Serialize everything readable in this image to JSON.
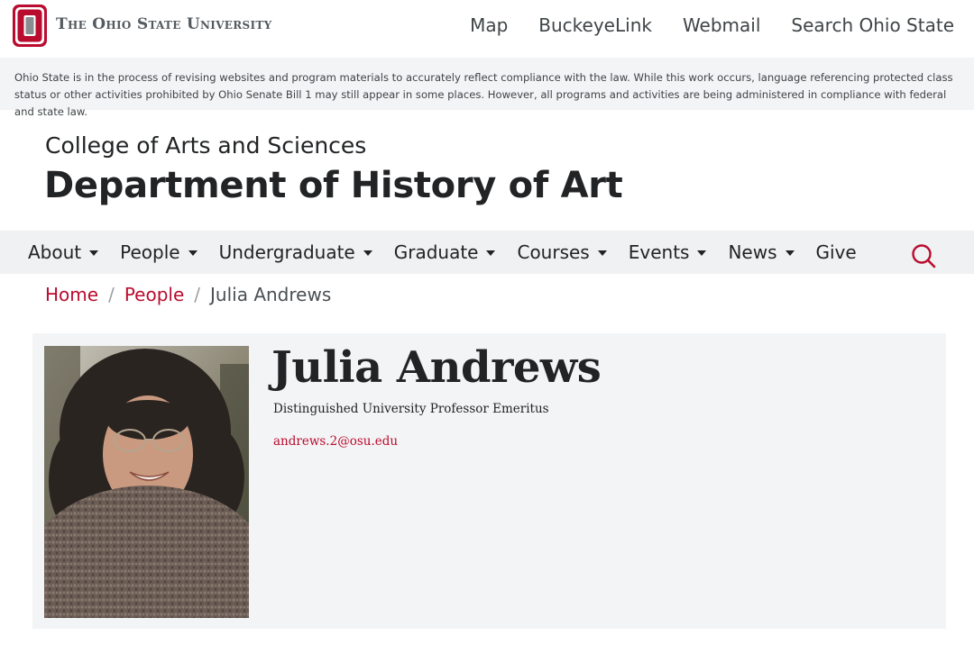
{
  "university": {
    "wordmark": "The Ohio State University",
    "logo_icon": "block-o-icon",
    "links": [
      "Map",
      "BuckeyeLink",
      "Webmail",
      "Search Ohio State"
    ]
  },
  "notice": {
    "text": "Ohio State is in the process of revising websites and program materials to accurately reflect compliance with the law. While this work occurs, language referencing protected class status or other activities prohibited by Ohio Senate Bill 1 may still appear in some places. However, all programs and activities are being administered in compliance with federal and state law."
  },
  "header": {
    "college": "College of Arts and Sciences",
    "department": "Department of History of Art"
  },
  "nav": {
    "items": [
      {
        "label": "About",
        "dropdown": true
      },
      {
        "label": "People",
        "dropdown": true
      },
      {
        "label": "Undergraduate",
        "dropdown": true
      },
      {
        "label": "Graduate",
        "dropdown": true
      },
      {
        "label": "Courses",
        "dropdown": true
      },
      {
        "label": "Events",
        "dropdown": true
      },
      {
        "label": "News",
        "dropdown": true
      },
      {
        "label": "Give",
        "dropdown": false
      }
    ],
    "search_icon": "search-icon"
  },
  "breadcrumb": {
    "home": "Home",
    "people": "People",
    "current": "Julia Andrews",
    "separator": "/"
  },
  "profile": {
    "name": "Julia Andrews",
    "title": "Distinguished University Professor Emeritus",
    "email": "andrews.2@osu.edu"
  },
  "colors": {
    "scarlet": "#ba0c2f",
    "gray_bg": "#eff1f2",
    "text": "#212325"
  }
}
